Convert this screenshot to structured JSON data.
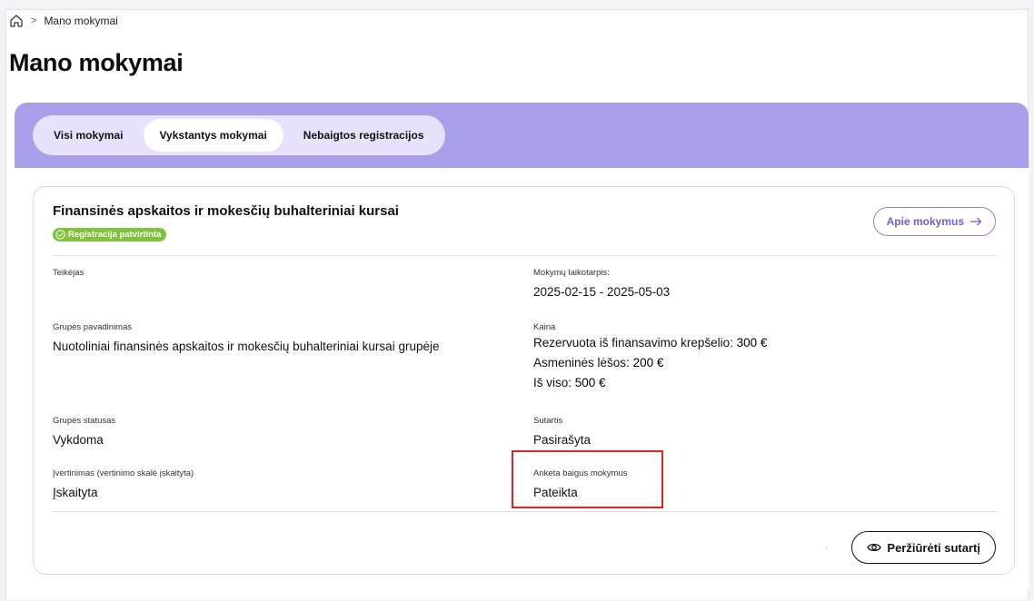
{
  "breadcrumb": {
    "current": "Mano mokymai",
    "separator": ">"
  },
  "page_title": "Mano mokymai",
  "tabs": [
    {
      "label": "Visi mokymai",
      "active": false
    },
    {
      "label": "Vykstantys mokymai",
      "active": true
    },
    {
      "label": "Nebaigtos registracijos",
      "active": false
    }
  ],
  "course": {
    "title": "Finansinės apskaitos ir mokesčių buhalteriniai kursai",
    "status_badge": "Registracija patvirtinta",
    "about_button": "Apie mokymus",
    "fields": {
      "provider_label": "Teikėjas",
      "provider_value": "",
      "period_label": "Mokymų laikotarpis:",
      "period_value": "2025-02-15 - 2025-05-03",
      "group_name_label": "Grupės pavadinimas",
      "group_name_value": "Nuotoliniai finansinės apskaitos ir mokesčių buhalteriniai kursai grupėje",
      "price_label": "Kaina",
      "price_reserved_text": "Rezervuota iš finansavimo krepšelio:",
      "price_reserved_amount": "300 €",
      "price_personal_text": "Asmeninės lėšos:",
      "price_personal_amount": "200 €",
      "price_total_text": "Iš viso:",
      "price_total_amount": "500 €",
      "group_status_label": "Grupės statusas",
      "group_status_value": "Vykdoma",
      "contract_label": "Sutartis",
      "contract_value": "Pasirašyta",
      "assessment_label": "Įvertinimas (vertinimo skalė įskaityta)",
      "assessment_value": "Įskaityta",
      "survey_label": "Anketa baigus mokymus",
      "survey_value": "Pateikta"
    },
    "review_button": "Peržiūrėti sutartį"
  },
  "colors": {
    "accent_band": "#a89fea",
    "tabs_bg": "#e6e2fb",
    "badge_green": "#7fc23b",
    "link_purple": "#6c5fd8",
    "highlight_red": "#e02424"
  },
  "icons": [
    "home-icon",
    "check-circle-icon",
    "arrow-right-icon",
    "eye-icon"
  ]
}
